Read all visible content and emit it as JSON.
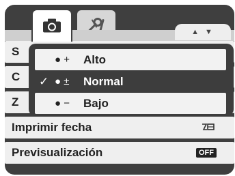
{
  "tabs": [
    {
      "name": "camera-icon"
    },
    {
      "name": "tools-icon"
    }
  ],
  "nav_arrows": "▲ ▼",
  "menu": {
    "items": [
      {
        "label": "S",
        "value": ""
      },
      {
        "label": "C",
        "value": ""
      },
      {
        "label": "Z",
        "value": ""
      },
      {
        "label": "Imprimir fecha",
        "value_icon": "date-stamp-icon"
      },
      {
        "label": "Previsualización",
        "value": "OFF"
      }
    ]
  },
  "popup": {
    "options": [
      {
        "symbol": "● +",
        "label": "Alto",
        "selected": false
      },
      {
        "symbol": "● ±",
        "label": "Normal",
        "selected": true,
        "check": "✓"
      },
      {
        "symbol": "● −",
        "label": "Bajo",
        "selected": false
      }
    ]
  },
  "colors": {
    "frame": "#3f3f3f",
    "row_bg": "#efefef",
    "selected_bg": "#3d3d3d"
  }
}
